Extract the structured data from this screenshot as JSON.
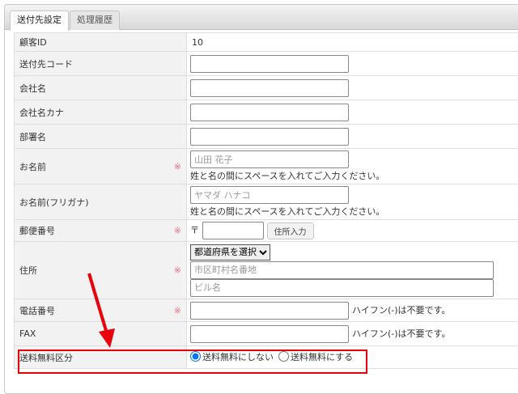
{
  "tabs": [
    {
      "label": "送付先設定",
      "active": true
    },
    {
      "label": "処理履歴",
      "active": false
    }
  ],
  "required_mark": "※",
  "rows": {
    "customer_id": {
      "label": "顧客ID",
      "value": "10"
    },
    "dest_code": {
      "label": "送付先コード",
      "value": ""
    },
    "company": {
      "label": "会社名",
      "value": ""
    },
    "company_kana": {
      "label": "会社名カナ",
      "value": ""
    },
    "department": {
      "label": "部署名",
      "value": ""
    },
    "name": {
      "label": "お名前",
      "placeholder": "山田 花子",
      "note": "姓と名の間にスペースを入れてご入力ください。"
    },
    "name_kana": {
      "label": "お名前(フリガナ)",
      "placeholder": "ヤマダ ハナコ",
      "note": "姓と名の間にスペースを入れてご入力ください。"
    },
    "postal": {
      "label": "郵便番号",
      "prefix": "〒",
      "button": "住所入力"
    },
    "address": {
      "label": "住所",
      "prefecture_selected": "都道府県を選択",
      "line1_placeholder": "市区町村名番地",
      "line2_placeholder": "ビル名"
    },
    "phone": {
      "label": "電話番号",
      "hint": "ハイフン(-)は不要です。"
    },
    "fax": {
      "label": "FAX",
      "hint": "ハイフン(-)は不要です。"
    },
    "free_shipping": {
      "label": "送料無料区分",
      "options": [
        "送料無料にしない",
        "送料無料にする"
      ],
      "selected": 0
    }
  },
  "annotation_color": "#e8000b"
}
